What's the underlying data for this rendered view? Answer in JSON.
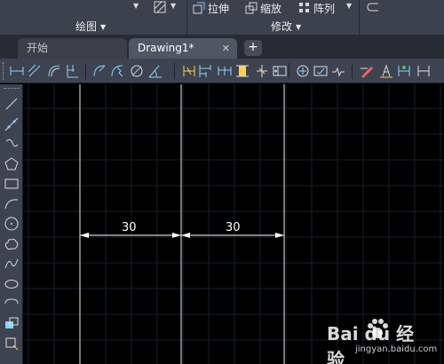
{
  "ribbon": {
    "panels": [
      {
        "title": "绘图"
      },
      {
        "title": "修改"
      }
    ],
    "commands": [
      {
        "label": "拉伸"
      },
      {
        "label": "缩放"
      },
      {
        "label": "阵列"
      }
    ]
  },
  "tabs": [
    {
      "label": "开始",
      "active": false
    },
    {
      "label": "Drawing1*",
      "active": true
    }
  ],
  "tab_close_glyph": "✕",
  "tab_add_glyph": "+",
  "dim_toolbar_icons": [
    "linear-dim-icon",
    "aligned-dim-icon",
    "arc-length-dim-icon",
    "ordinate-dim-icon",
    "radius-dim-icon",
    "jogged-dim-icon",
    "diameter-dim-icon",
    "angular-dim-icon",
    "quick-dim-icon",
    "baseline-dim-icon",
    "continue-dim-icon",
    "dim-space-icon",
    "dim-break-icon",
    "tolerance-icon",
    "center-mark-icon",
    "inspection-icon",
    "jogged-linear-icon",
    "dim-edit-icon",
    "dim-text-edit-icon",
    "dim-update-icon",
    "dim-style-icon"
  ],
  "draw_toolbar_icons": [
    "line-icon",
    "construction-line-icon",
    "polyline-icon",
    "polygon-icon",
    "rectangle-icon",
    "arc-icon",
    "circle-icon",
    "revision-cloud-icon",
    "spline-icon",
    "ellipse-icon",
    "ellipse-arc-icon",
    "insert-block-icon",
    "make-block-icon"
  ],
  "drawing": {
    "dimensions": [
      {
        "value": "30"
      },
      {
        "value": "30"
      }
    ]
  },
  "watermark": {
    "brand": "Bai du 经验",
    "url": "jingyan.baidu.com"
  },
  "colors": {
    "ribbon_bg": "#3b414d",
    "toolbar_bg": "#3d4350",
    "canvas_bg": "#000000",
    "dim_line": "#ffffff",
    "grid": "#1a2430"
  }
}
